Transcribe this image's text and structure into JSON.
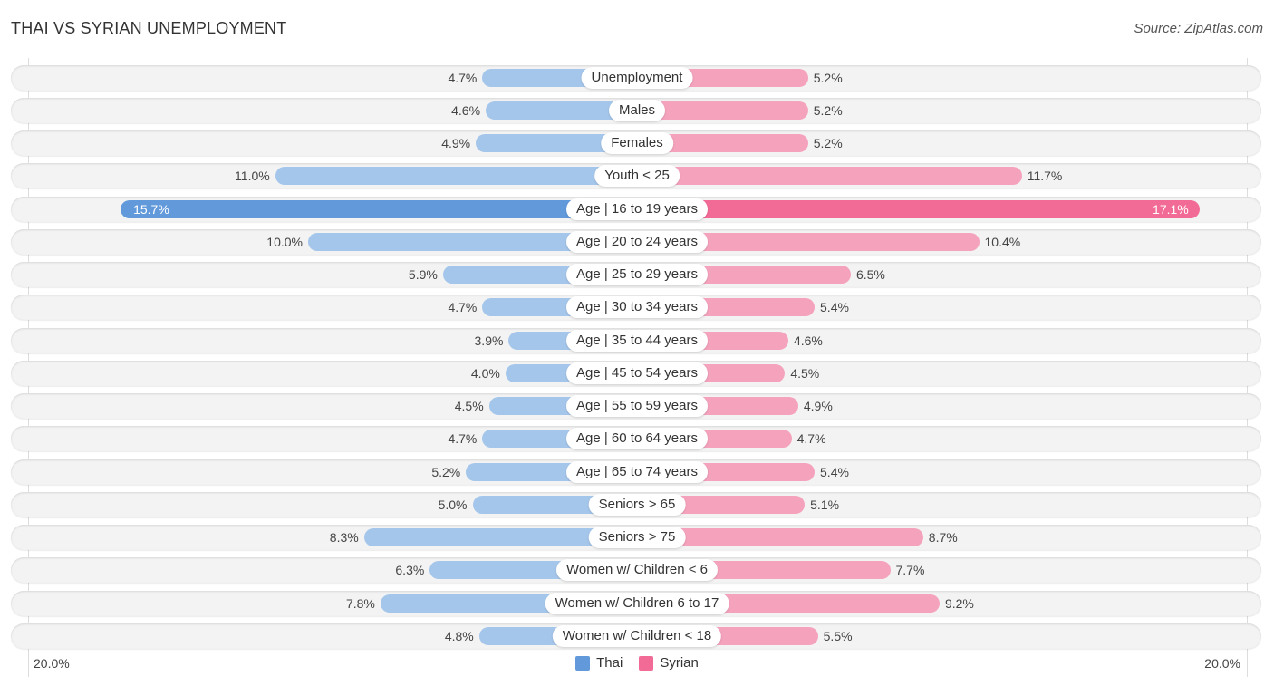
{
  "header": {
    "title": "THAI VS SYRIAN UNEMPLOYMENT",
    "source": "Source: ZipAtlas.com"
  },
  "colors": {
    "thai": "#6199db",
    "thai_light": "#a5c6eb",
    "syrian": "#f26b96",
    "syrian_light": "#f5a3bd"
  },
  "chart_data": {
    "type": "bar",
    "orientation": "horizontal-diverging",
    "title": "THAI VS SYRIAN UNEMPLOYMENT",
    "xlabel": "",
    "ylabel": "",
    "xlim": [
      0,
      20.0
    ],
    "axis_labels": {
      "left": "20.0%",
      "right": "20.0%"
    },
    "legend_position": "bottom-center",
    "categories": [
      "Unemployment",
      "Males",
      "Females",
      "Youth < 25",
      "Age | 16 to 19 years",
      "Age | 20 to 24 years",
      "Age | 25 to 29 years",
      "Age | 30 to 34 years",
      "Age | 35 to 44 years",
      "Age | 45 to 54 years",
      "Age | 55 to 59 years",
      "Age | 60 to 64 years",
      "Age | 65 to 74 years",
      "Seniors > 65",
      "Seniors > 75",
      "Women w/ Children < 6",
      "Women w/ Children 6 to 17",
      "Women w/ Children < 18"
    ],
    "series": [
      {
        "name": "Thai",
        "values": [
          4.7,
          4.6,
          4.9,
          11.0,
          15.7,
          10.0,
          5.9,
          4.7,
          3.9,
          4.0,
          4.5,
          4.7,
          5.2,
          5.0,
          8.3,
          6.3,
          7.8,
          4.8
        ],
        "labels": [
          "4.7%",
          "4.6%",
          "4.9%",
          "11.0%",
          "15.7%",
          "10.0%",
          "5.9%",
          "4.7%",
          "3.9%",
          "4.0%",
          "4.5%",
          "4.7%",
          "5.2%",
          "5.0%",
          "8.3%",
          "6.3%",
          "7.8%",
          "4.8%"
        ]
      },
      {
        "name": "Syrian",
        "values": [
          5.2,
          5.2,
          5.2,
          11.7,
          17.1,
          10.4,
          6.5,
          5.4,
          4.6,
          4.5,
          4.9,
          4.7,
          5.4,
          5.1,
          8.7,
          7.7,
          9.2,
          5.5
        ],
        "labels": [
          "5.2%",
          "5.2%",
          "5.2%",
          "11.7%",
          "17.1%",
          "10.4%",
          "6.5%",
          "5.4%",
          "4.6%",
          "4.5%",
          "4.9%",
          "4.7%",
          "5.4%",
          "5.1%",
          "8.7%",
          "7.7%",
          "9.2%",
          "5.5%"
        ]
      }
    ]
  },
  "legend": {
    "items": [
      {
        "label": "Thai",
        "color": "#6199db"
      },
      {
        "label": "Syrian",
        "color": "#f26b96"
      }
    ]
  }
}
